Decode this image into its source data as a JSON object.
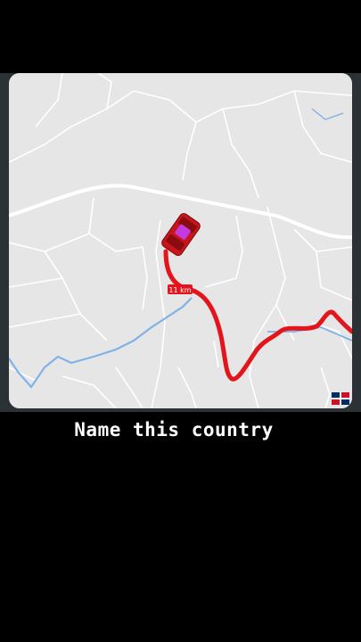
{
  "map": {
    "distance_label": "11 km",
    "route_color": "#e3141b",
    "water_color": "#7fb2e6",
    "road_color": "#ffffff",
    "land_color": "#e6e6e6",
    "vehicle": "red car icon",
    "flag": "dominican-republic-flag"
  },
  "caption": {
    "text": "Name this country"
  }
}
